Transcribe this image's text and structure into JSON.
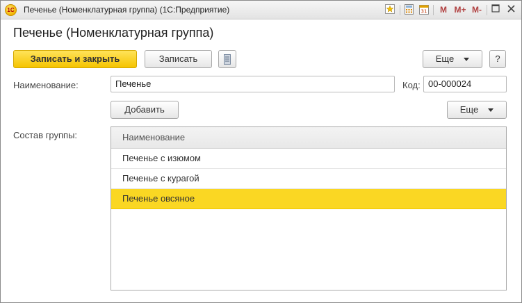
{
  "window": {
    "title": "Печенье (Номенклатурная группа)  (1С:Предприятие)",
    "app_logo_text": "1С",
    "controls": {
      "m": "M",
      "m_plus": "M+",
      "m_minus": "M-"
    }
  },
  "form": {
    "title": "Печенье (Номенклатурная группа)",
    "toolbar": {
      "save_close_label": "Записать и закрыть",
      "save_label": "Записать",
      "more_label": "Еще",
      "help_label": "?"
    },
    "name_label": "Наименование:",
    "name_value": "Печенье",
    "code_label": "Код:",
    "code_value": "00-000024",
    "add_label": "Добавить",
    "more2_label": "Еще",
    "group_label": "Состав группы:",
    "table": {
      "header": "Наименование",
      "rows": [
        "Печенье с изюмом",
        "Печенье с курагой",
        "Печенье овсяное"
      ],
      "selected_index": 2
    }
  },
  "colors": {
    "accent": "#f5c400",
    "selected_row": "#fad723"
  },
  "icons": [
    "star-icon",
    "calculator-icon",
    "calendar-icon",
    "restore-icon",
    "close-icon",
    "list-icon",
    "caret-down-icon"
  ]
}
